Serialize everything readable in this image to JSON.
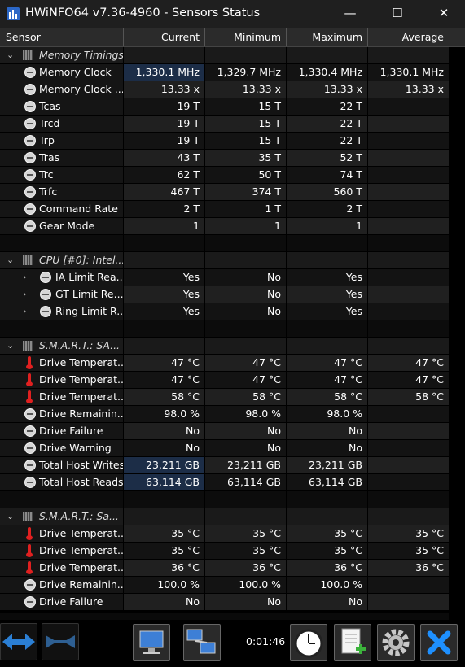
{
  "window": {
    "title": "HWiNFO64 v7.36-4960 - Sensors Status",
    "minimize": "—",
    "maximize": "☐",
    "close": "✕"
  },
  "columns": [
    "Sensor",
    "Current",
    "Minimum",
    "Maximum",
    "Average"
  ],
  "rows": [
    {
      "type": "group",
      "label": "Memory Timings"
    },
    {
      "type": "sensor",
      "icon": "gauge",
      "label": "Memory Clock",
      "v": [
        "1,330.1 MHz",
        "1,329.7 MHz",
        "1,330.4 MHz",
        "1,330.1 MHz"
      ],
      "highlight": true
    },
    {
      "type": "sensor",
      "icon": "gauge",
      "label": "Memory Clock ...",
      "v": [
        "13.33 x",
        "13.33 x",
        "13.33 x",
        "13.33 x"
      ]
    },
    {
      "type": "sensor",
      "icon": "gauge",
      "label": "Tcas",
      "v": [
        "19 T",
        "15 T",
        "22 T",
        ""
      ]
    },
    {
      "type": "sensor",
      "icon": "gauge",
      "label": "Trcd",
      "v": [
        "19 T",
        "15 T",
        "22 T",
        ""
      ]
    },
    {
      "type": "sensor",
      "icon": "gauge",
      "label": "Trp",
      "v": [
        "19 T",
        "15 T",
        "22 T",
        ""
      ]
    },
    {
      "type": "sensor",
      "icon": "gauge",
      "label": "Tras",
      "v": [
        "43 T",
        "35 T",
        "52 T",
        ""
      ]
    },
    {
      "type": "sensor",
      "icon": "gauge",
      "label": "Trc",
      "v": [
        "62 T",
        "50 T",
        "74 T",
        ""
      ]
    },
    {
      "type": "sensor",
      "icon": "gauge",
      "label": "Trfc",
      "v": [
        "467 T",
        "374 T",
        "560 T",
        ""
      ]
    },
    {
      "type": "sensor",
      "icon": "gauge",
      "label": "Command Rate",
      "v": [
        "2 T",
        "1 T",
        "2 T",
        ""
      ]
    },
    {
      "type": "sensor",
      "icon": "gauge",
      "label": "Gear Mode",
      "v": [
        "1",
        "1",
        "1",
        ""
      ]
    },
    {
      "type": "spacer"
    },
    {
      "type": "group",
      "label": "CPU [#0]: Intel..."
    },
    {
      "type": "sensor",
      "icon": "gauge",
      "expand": true,
      "label": "IA Limit Rea...",
      "v": [
        "Yes",
        "No",
        "Yes",
        ""
      ]
    },
    {
      "type": "sensor",
      "icon": "gauge",
      "expand": true,
      "label": "GT Limit Re...",
      "v": [
        "Yes",
        "No",
        "Yes",
        ""
      ]
    },
    {
      "type": "sensor",
      "icon": "gauge",
      "expand": true,
      "label": "Ring Limit R...",
      "v": [
        "Yes",
        "No",
        "Yes",
        ""
      ]
    },
    {
      "type": "spacer"
    },
    {
      "type": "group",
      "label": "S.M.A.R.T.: SA..."
    },
    {
      "type": "sensor",
      "icon": "thermometer",
      "label": "Drive Temperat...",
      "v": [
        "47 °C",
        "47 °C",
        "47 °C",
        "47 °C"
      ]
    },
    {
      "type": "sensor",
      "icon": "thermometer",
      "label": "Drive Temperat...",
      "v": [
        "47 °C",
        "47 °C",
        "47 °C",
        "47 °C"
      ]
    },
    {
      "type": "sensor",
      "icon": "thermometer",
      "label": "Drive Temperat...",
      "v": [
        "58 °C",
        "58 °C",
        "58 °C",
        "58 °C"
      ]
    },
    {
      "type": "sensor",
      "icon": "gauge",
      "label": "Drive Remainin...",
      "v": [
        "98.0 %",
        "98.0 %",
        "98.0 %",
        ""
      ]
    },
    {
      "type": "sensor",
      "icon": "gauge",
      "label": "Drive Failure",
      "v": [
        "No",
        "No",
        "No",
        ""
      ]
    },
    {
      "type": "sensor",
      "icon": "gauge",
      "label": "Drive Warning",
      "v": [
        "No",
        "No",
        "No",
        ""
      ]
    },
    {
      "type": "sensor",
      "icon": "gauge",
      "label": "Total Host Writes",
      "v": [
        "23,211 GB",
        "23,211 GB",
        "23,211 GB",
        ""
      ],
      "highlight": true
    },
    {
      "type": "sensor",
      "icon": "gauge",
      "label": "Total Host Reads",
      "v": [
        "63,114 GB",
        "63,114 GB",
        "63,114 GB",
        ""
      ],
      "highlight": true
    },
    {
      "type": "spacer"
    },
    {
      "type": "group",
      "label": "S.M.A.R.T.: Sa..."
    },
    {
      "type": "sensor",
      "icon": "thermometer",
      "label": "Drive Temperat...",
      "v": [
        "35 °C",
        "35 °C",
        "35 °C",
        "35 °C"
      ]
    },
    {
      "type": "sensor",
      "icon": "thermometer",
      "label": "Drive Temperat...",
      "v": [
        "35 °C",
        "35 °C",
        "35 °C",
        "35 °C"
      ]
    },
    {
      "type": "sensor",
      "icon": "thermometer",
      "label": "Drive Temperat...",
      "v": [
        "36 °C",
        "36 °C",
        "36 °C",
        "36 °C"
      ]
    },
    {
      "type": "sensor",
      "icon": "gauge",
      "label": "Drive Remainin...",
      "v": [
        "100.0 %",
        "100.0 %",
        "100.0 %",
        ""
      ]
    },
    {
      "type": "sensor",
      "icon": "gauge",
      "label": "Drive Failure",
      "v": [
        "No",
        "No",
        "No",
        ""
      ]
    }
  ],
  "toolbar": {
    "timer": "0:01:46",
    "buttons": [
      "expand-collapse-arrows-icon",
      "collapse-arrows-icon",
      "network-computer-icon",
      "network-computers-icon",
      "clock-icon",
      "add-report-icon",
      "settings-gear-icon",
      "close-x-icon"
    ]
  },
  "colors": {
    "highlight": "#1c2d47",
    "accent_blue": "#2b7fd4",
    "close_blue": "#1e90ff"
  }
}
